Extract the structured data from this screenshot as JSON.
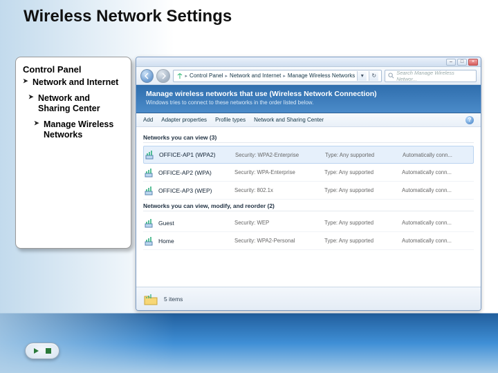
{
  "title": "Wireless Network Settings",
  "panel": {
    "heading": "Control Panel",
    "l1": "Network and Internet",
    "l2": "Network and Sharing Center",
    "l3": "Manage Wireless Networks"
  },
  "window": {
    "nav": {
      "crumb1": "Control Panel",
      "crumb2": "Network and Internet",
      "crumb3": "Manage Wireless Networks",
      "search_placeholder": "Search Manage Wireless Networ..."
    },
    "header": {
      "title": "Manage wireless networks that use (Wireless Network Connection)",
      "subtitle": "Windows tries to connect to these networks in the order listed below."
    },
    "toolbar": {
      "add": "Add",
      "adapter": "Adapter properties",
      "profile": "Profile types",
      "center": "Network and Sharing Center"
    },
    "sections": {
      "view_label": "Networks you can view (3)",
      "modify_label": "Networks you can view, modify, and reorder (2)"
    },
    "networks_view": [
      {
        "name": "OFFICE-AP1 (WPA2)",
        "security": "Security: WPA2-Enterprise",
        "type": "Type: Any supported",
        "conn": "Automatically conn..."
      },
      {
        "name": "OFFICE-AP2 (WPA)",
        "security": "Security: WPA-Enterprise",
        "type": "Type: Any supported",
        "conn": "Automatically conn..."
      },
      {
        "name": "OFFICE-AP3 (WEP)",
        "security": "Security: 802.1x",
        "type": "Type: Any supported",
        "conn": "Automatically conn..."
      }
    ],
    "networks_modify": [
      {
        "name": "Guest",
        "security": "Security: WEP",
        "type": "Type: Any supported",
        "conn": "Automatically conn..."
      },
      {
        "name": "Home",
        "security": "Security: WPA2-Personal",
        "type": "Type: Any supported",
        "conn": "Automatically conn..."
      }
    ],
    "status": "5 items"
  }
}
